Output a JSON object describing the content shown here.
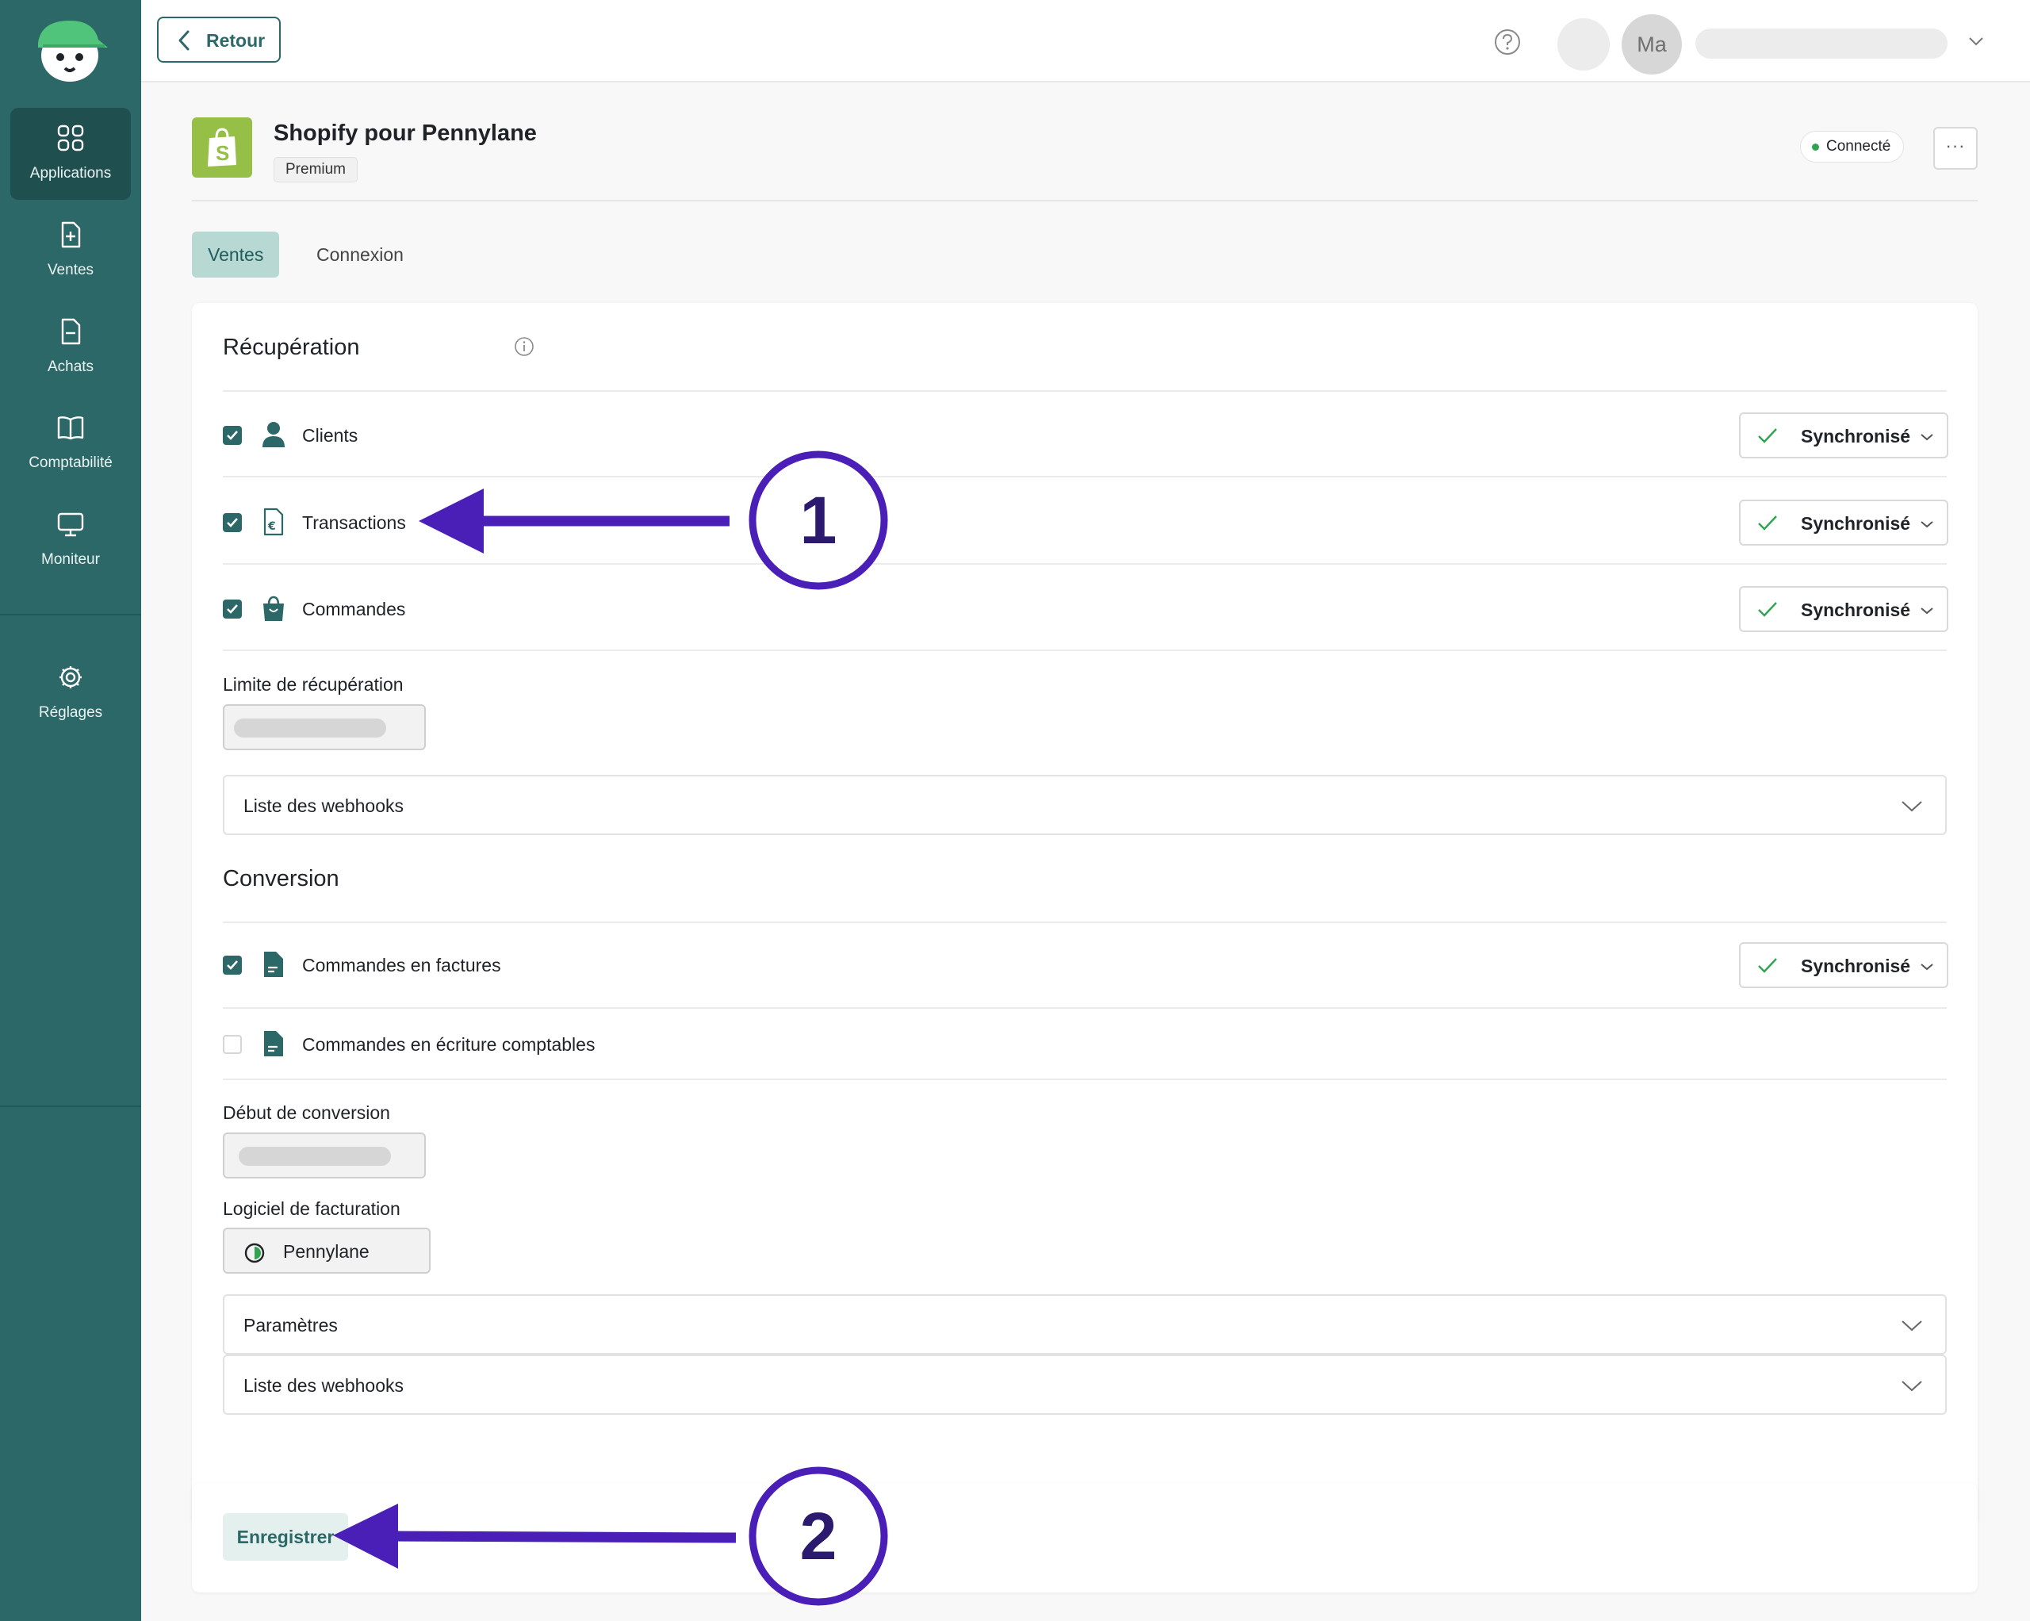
{
  "sidebar": {
    "items": [
      {
        "label": "Applications",
        "icon": "grid-icon",
        "active": true
      },
      {
        "label": "Ventes",
        "icon": "document-plus-icon"
      },
      {
        "label": "Achats",
        "icon": "document-minus-icon"
      },
      {
        "label": "Comptabilité",
        "icon": "book-icon"
      },
      {
        "label": "Moniteur",
        "icon": "monitor-icon"
      },
      {
        "label": "Réglages",
        "icon": "gear-icon"
      }
    ]
  },
  "topbar": {
    "back_label": "Retour",
    "avatar_initials": "Ma"
  },
  "app": {
    "title": "Shopify pour Pennylane",
    "plan_badge": "Premium",
    "status": "Connecté",
    "more": "···"
  },
  "tabs": [
    {
      "label": "Ventes",
      "active": true
    },
    {
      "label": "Connexion",
      "active": false
    }
  ],
  "recuperation": {
    "title": "Récupération",
    "rows": [
      {
        "label": "Clients",
        "checked": true,
        "status": "Synchronisé"
      },
      {
        "label": "Transactions",
        "checked": true,
        "status": "Synchronisé"
      },
      {
        "label": "Commandes",
        "checked": true,
        "status": "Synchronisé"
      }
    ],
    "limit_label": "Limite de récupération",
    "webhooks_label": "Liste des webhooks"
  },
  "conversion": {
    "title": "Conversion",
    "rows": [
      {
        "label": "Commandes en factures",
        "checked": true,
        "status": "Synchronisé"
      },
      {
        "label": "Commandes en écriture comptables",
        "checked": false
      }
    ],
    "start_label": "Début de conversion",
    "billing_label": "Logiciel de facturation",
    "billing_value": "Pennylane",
    "params_label": "Paramètres",
    "webhooks_label": "Liste des webhooks"
  },
  "save_label": "Enregistrer",
  "annotations": {
    "step1": "1",
    "step2": "2"
  },
  "colors": {
    "sidebar": "#2c6867",
    "accent": "#2c6867",
    "annotation": "#4a1fb8",
    "shopify": "#95bf47",
    "connected_dot": "#2fa34f"
  }
}
